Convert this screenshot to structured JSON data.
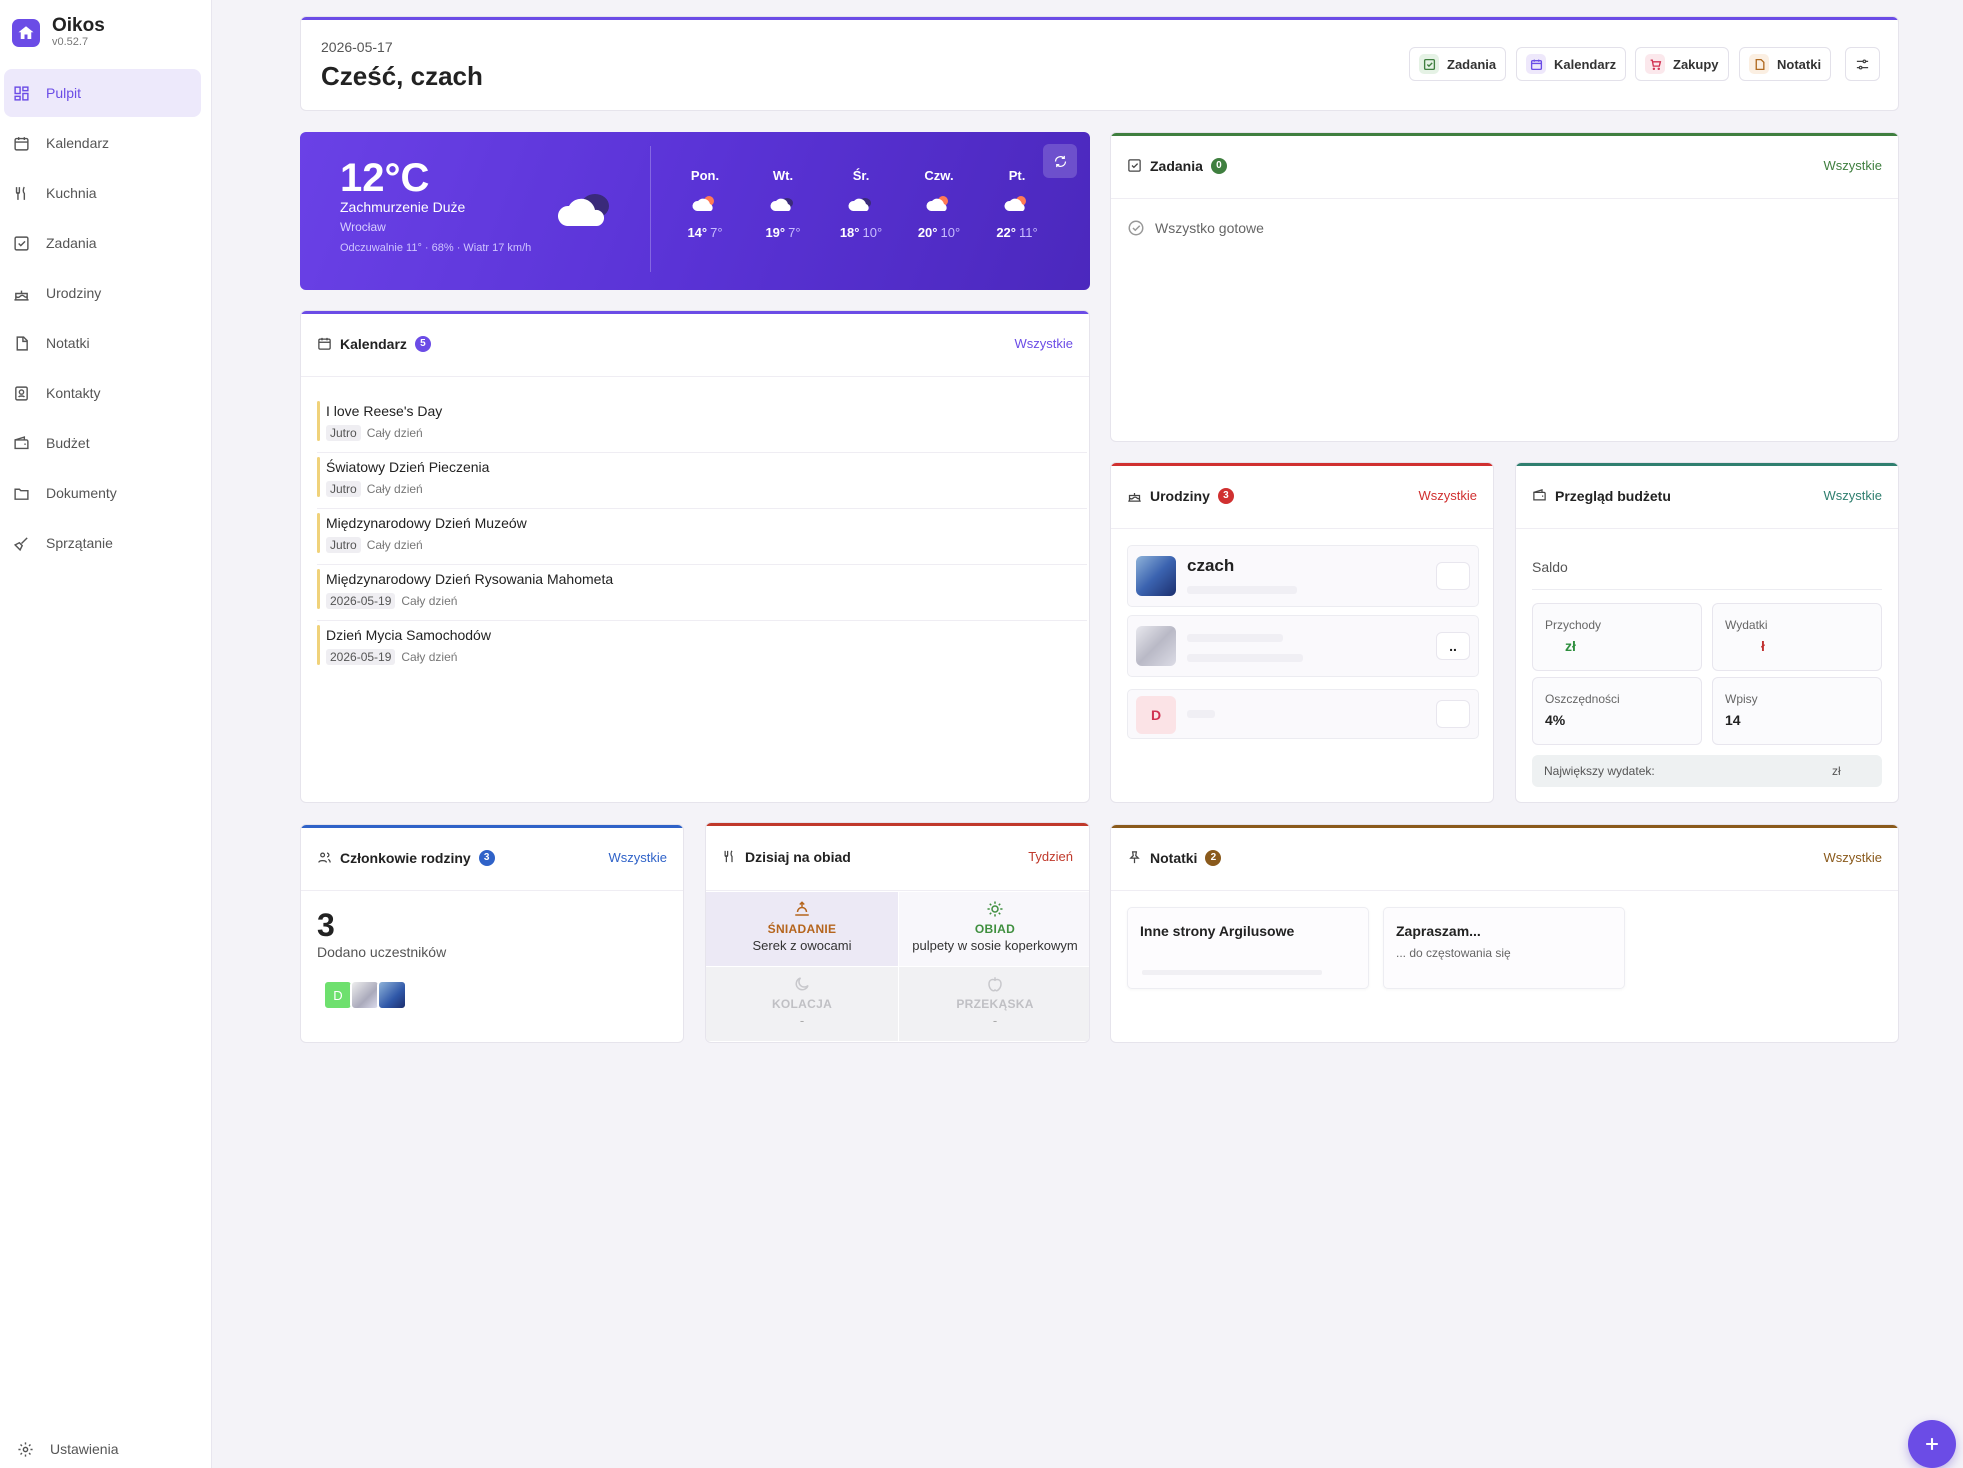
{
  "app": {
    "name": "Oikos",
    "version": "v0.52.7"
  },
  "sidebar": {
    "items": [
      {
        "label": "Pulpit",
        "icon": "dashboard-icon"
      },
      {
        "label": "Kalendarz",
        "icon": "calendar-icon"
      },
      {
        "label": "Kuchnia",
        "icon": "utensils-icon"
      },
      {
        "label": "Zadania",
        "icon": "checkbox-icon"
      },
      {
        "label": "Urodziny",
        "icon": "cake-icon"
      },
      {
        "label": "Notatki",
        "icon": "note-icon"
      },
      {
        "label": "Kontakty",
        "icon": "contact-book-icon"
      },
      {
        "label": "Budżet",
        "icon": "wallet-icon"
      },
      {
        "label": "Dokumenty",
        "icon": "folder-icon"
      },
      {
        "label": "Sprzątanie",
        "icon": "broom-icon"
      }
    ],
    "settings_label": "Ustawienia",
    "active_index": 0
  },
  "header": {
    "date": "2026-05-17",
    "greeting": "Cześć, czach",
    "quick_links": [
      "Zadania",
      "Kalendarz",
      "Zakupy",
      "Notatki"
    ]
  },
  "weather": {
    "temp": "12°C",
    "condition": "Zachmurzenie Duże",
    "city": "Wrocław",
    "details": "Odczuwalnie 11° · 68% · Wiatr 17 km/h",
    "forecast": [
      {
        "day": "Pon.",
        "high": "14°",
        "low": "7°",
        "icon": "sun-cloud-icon"
      },
      {
        "day": "Wt.",
        "high": "19°",
        "low": "7°",
        "icon": "cloud-icon"
      },
      {
        "day": "Śr.",
        "high": "18°",
        "low": "10°",
        "icon": "cloud-icon"
      },
      {
        "day": "Czw.",
        "high": "20°",
        "low": "10°",
        "icon": "sun-cloud-icon"
      },
      {
        "day": "Pt.",
        "high": "22°",
        "low": "11°",
        "icon": "sun-cloud-icon"
      }
    ]
  },
  "tasks": {
    "title": "Zadania",
    "count": "0",
    "more": "Wszystkie",
    "empty": "Wszystko gotowe"
  },
  "calendar": {
    "title": "Kalendarz",
    "count": "5",
    "more": "Wszystkie",
    "events": [
      {
        "title": "I love Reese's Day",
        "when": "Jutro",
        "time": "Cały dzień"
      },
      {
        "title": "Światowy Dzień Pieczenia",
        "when": "Jutro",
        "time": "Cały dzień"
      },
      {
        "title": "Międzynarodowy Dzień Muzeów",
        "when": "Jutro",
        "time": "Cały dzień"
      },
      {
        "title": "Międzynarodowy Dzień Rysowania Mahometa",
        "when": "2026-05-19",
        "time": "Cały dzień"
      },
      {
        "title": "Dzień Mycia Samochodów",
        "when": "2026-05-19",
        "time": "Cały dzień"
      }
    ]
  },
  "birthdays": {
    "title": "Urodziny",
    "count": "3",
    "more": "Wszystkie",
    "people": [
      {
        "name": "czach",
        "btn": "",
        "initial": ""
      },
      {
        "name": "",
        "btn": "..",
        "initial": ""
      },
      {
        "name": "",
        "btn": "",
        "initial": "D"
      }
    ]
  },
  "budget": {
    "title": "Przegląd budżetu",
    "more": "Wszystkie",
    "saldo_label": "Saldo",
    "income_label": "Przychody",
    "income_value": "zł",
    "expense_label": "Wydatki",
    "expense_value": "ł",
    "savings_label": "Oszczędności",
    "savings_value": "4%",
    "entries_label": "Wpisy",
    "entries_value": "14",
    "largest_label": "Największy wydatek:",
    "largest_value": "zł"
  },
  "family": {
    "title": "Członkowie rodziny",
    "count": "3",
    "more": "Wszystkie",
    "number": "3",
    "subtitle": "Dodano uczestników",
    "first_initial": "D"
  },
  "meals": {
    "title": "Dzisiaj na obiad",
    "more": "Tydzień",
    "slots": [
      {
        "label": "ŚNIADANIE",
        "dish": "Serek z owocami"
      },
      {
        "label": "OBIAD",
        "dish": "pulpety w sosie koperkowym"
      },
      {
        "label": "KOLACJA",
        "dish": "-"
      },
      {
        "label": "PRZEKĄSKA",
        "dish": "-"
      }
    ]
  },
  "notes": {
    "title": "Notatki",
    "count": "2",
    "more": "Wszystkie",
    "items": [
      {
        "title": "Inne strony Argilusowe",
        "body": ""
      },
      {
        "title": "Zapraszam...",
        "body": "... do częstowania się"
      }
    ]
  },
  "colors": {
    "accent": "#6b4ce6",
    "tasks": "#3f7f3f",
    "birthdays": "#d03030",
    "budget": "#2f7f6f",
    "family": "#2f62c8",
    "meals": "#c0392b",
    "notes": "#8a5a1c"
  }
}
